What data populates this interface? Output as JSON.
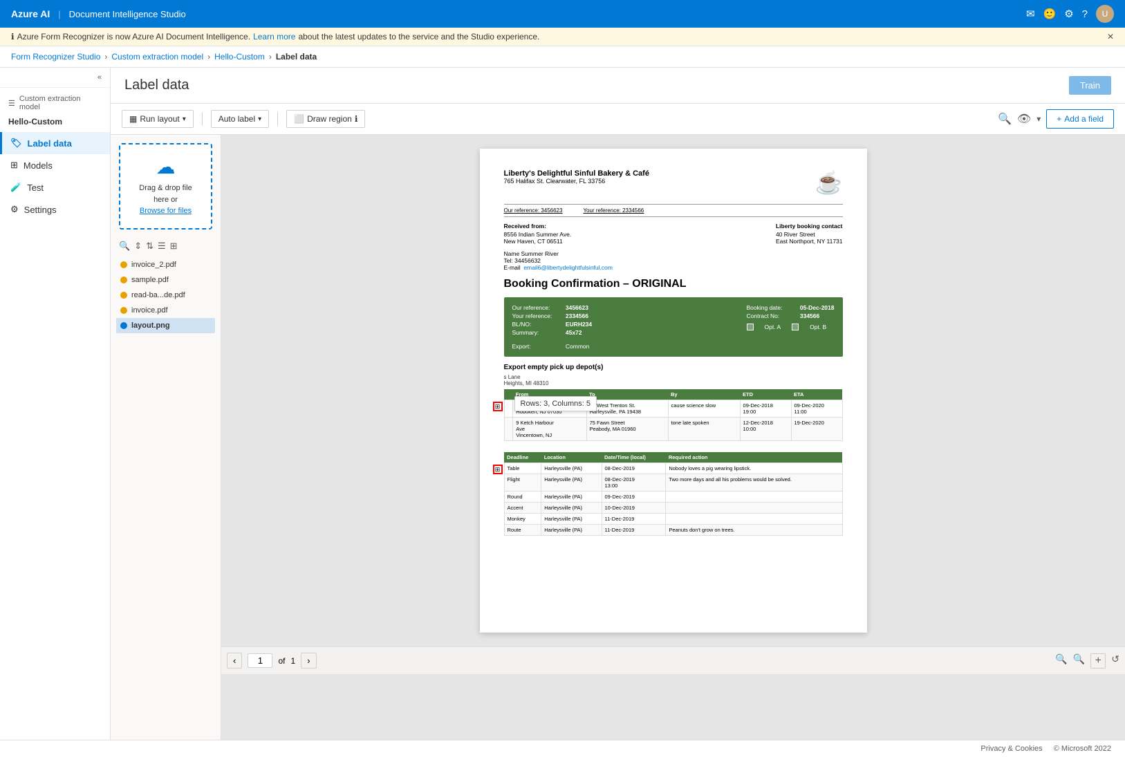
{
  "app": {
    "title": "Azure AI | Document Intelligence Studio",
    "logo": "Azure AI",
    "divider": "|",
    "name": "Document Intelligence Studio"
  },
  "notification": {
    "info_icon": "ℹ",
    "text": "Azure Form Recognizer is now Azure AI Document Intelligence.",
    "link_text": "Learn more",
    "link_suffix": "about the latest updates to the service and the Studio experience.",
    "close": "✕"
  },
  "breadcrumb": {
    "items": [
      {
        "label": "Form Recognizer Studio",
        "href": "#"
      },
      {
        "label": "Custom extraction model",
        "href": "#"
      },
      {
        "label": "Hello-Custom",
        "href": "#"
      },
      {
        "label": "Label data",
        "current": true
      }
    ],
    "sep": "›"
  },
  "sidebar": {
    "toggle_icon": "«",
    "menu_icon": "☰",
    "section_title": "Custom extraction model",
    "project_name": "Hello-Custom",
    "nav_items": [
      {
        "icon": "🏷",
        "label": "Label data",
        "active": true
      },
      {
        "icon": "⊞",
        "label": "Models",
        "active": false
      },
      {
        "icon": "🧪",
        "label": "Test",
        "active": false
      },
      {
        "icon": "⚙",
        "label": "Settings",
        "active": false
      }
    ]
  },
  "page": {
    "title": "Label data",
    "train_button": "Train"
  },
  "toolbar": {
    "run_layout": "Run layout",
    "run_layout_icon": "▦",
    "chevron": "▾",
    "auto_label": "Auto label",
    "draw_region": "Draw region",
    "info_icon": "ℹ",
    "search_icon": "🔍",
    "eye_icon": "👁",
    "add_field": "+ Add a field"
  },
  "upload": {
    "icon": "☁",
    "line1": "Drag & drop file",
    "line2": "here or",
    "link": "Browse for files"
  },
  "file_tools": {
    "icons": [
      "🔍",
      "⇕",
      "⇅",
      "☰",
      "⊞"
    ]
  },
  "files": [
    {
      "name": "invoice_2.pdf",
      "dot": "orange",
      "active": false
    },
    {
      "name": "sample.pdf",
      "dot": "orange",
      "active": false
    },
    {
      "name": "read-ba...de.pdf",
      "dot": "orange",
      "active": false
    },
    {
      "name": "invoice.pdf",
      "dot": "orange",
      "active": false
    },
    {
      "name": "layout.png",
      "dot": "blue",
      "active": true
    }
  ],
  "tooltip": {
    "text": "Rows: 3, Columns: 5"
  },
  "document": {
    "company_name": "Liberty's Delightful Sinful Bakery & Café",
    "company_address": "765 Halifax St. Clearwater, FL 33756",
    "our_ref_label": "Our reference:",
    "our_ref": "3456623",
    "your_ref_label": "Your reference:",
    "your_ref": "2334566",
    "from_label": "Received from:",
    "from_address1": "8556 Indian Summer Ave.",
    "from_address2": "New Haven, CT 06511",
    "contact_label": "Liberty booking contact",
    "contact_address1": "40 River Street",
    "contact_address2": "East Northport, NY 11731",
    "name_label": "Name Summer River",
    "tel_label": "Tel: 34456632",
    "email_label": "E-mail",
    "email_link": "email6@libertydelightfulsinful.com",
    "booking_title": "Booking Confirmation – ORIGINAL",
    "booking": {
      "our_ref_label": "Our reference:",
      "our_ref_val": "3456623",
      "your_ref_label": "Your reference:",
      "your_ref_val": "2334566",
      "blno_label": "BL/NO:",
      "blno_val": "EURH234",
      "summary_label": "Summary:",
      "summary_val": "45x72",
      "booking_date_label": "Booking date:",
      "booking_date_val": "05-Dec-2018",
      "contract_label": "Contract No:",
      "contract_val": "334566",
      "export_label": "Export:",
      "export_val": "Common",
      "opt_a": "Opt. A",
      "opt_b": "Opt. B"
    },
    "depot_title": "Export empty pick up depot(s)",
    "table1": {
      "headers": [
        "",
        "From",
        "To",
        "By",
        "ETD",
        "ETA"
      ],
      "rows": [
        [
          "",
          "118 Queen Street\nHoboken, NJ 07030",
          "52 West Trenton St.\nHarleysville, PA 19438",
          "cause science slow",
          "09-Dec-2018\n19:00",
          "09-Dec-2020\n11:00"
        ],
        [
          "",
          "9 Ketch Harbour\nAve\nVincentown, NJ",
          "75 Fawn Street\nPeabody, MA 01960",
          "tone late spoken",
          "12-Dec-2018\n10:00",
          "19-Dec-2020"
        ]
      ]
    },
    "table2": {
      "headers": [
        "Deadline",
        "Location",
        "Date/Time (local)",
        "Required action"
      ],
      "rows": [
        [
          "Table",
          "Harleysville (PA)",
          "08-Dec-2019",
          "Nobody loves a pig wearing lipstick."
        ],
        [
          "Flight",
          "Harleysville (PA)",
          "08-Dec-2019\n13:00",
          "Two more days and all his problems would be solved."
        ],
        [
          "Round",
          "Harleysville (PA)",
          "09-Dec-2019",
          ""
        ],
        [
          "Accent",
          "Harleysville (PA)",
          "10-Dec-2019",
          ""
        ],
        [
          "Monkey",
          "Harleysville (PA)",
          "11-Dec-2019",
          ""
        ],
        [
          "Route",
          "Harleysville (PA)",
          "11-Dec-2019",
          "Peanuts don't grow on trees."
        ]
      ]
    },
    "pre_table_text": "s Lane\nHeights, MI 48310"
  },
  "pagination": {
    "prev": "‹",
    "page": "1",
    "of": "of",
    "total": "1",
    "next": "›"
  },
  "zoom": {
    "zoom_out": "🔍",
    "zoom_in": "🔍",
    "fit": "+",
    "reset": "↺"
  },
  "footer": {
    "privacy": "Privacy & Cookies",
    "copyright": "© Microsoft 2022"
  }
}
